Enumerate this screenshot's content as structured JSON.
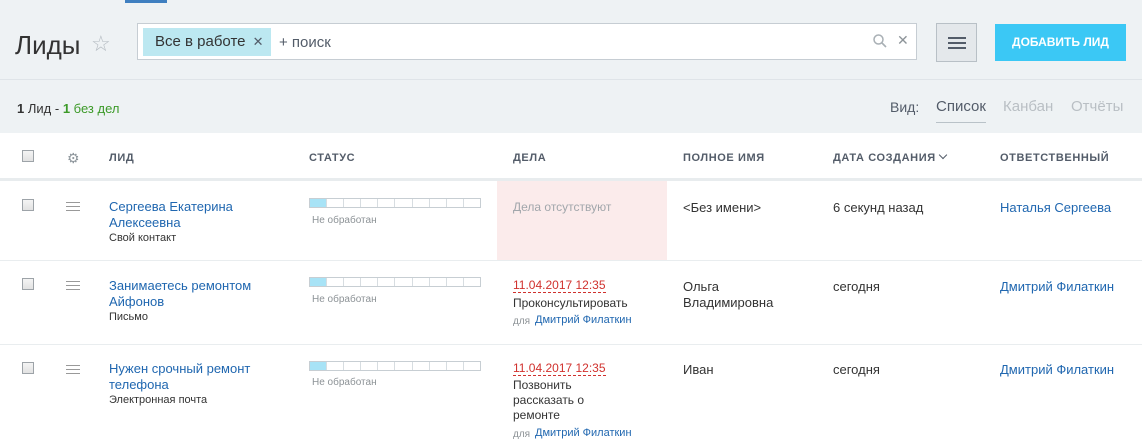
{
  "header": {
    "title": "Лиды",
    "add_button": "ДОБАВИТЬ ЛИД"
  },
  "search": {
    "filter_tag": "Все в работе",
    "placeholder": "+ поиск"
  },
  "summary": {
    "count": "1",
    "count_label": "Лид -",
    "no_deals_count": "1",
    "no_deals_label": "без дел"
  },
  "view": {
    "label": "Вид:",
    "tabs": [
      "Список",
      "Канбан",
      "Отчёты"
    ],
    "active": "Список"
  },
  "columns": {
    "lead": "ЛИД",
    "status": "СТАТУС",
    "deals": "ДЕЛА",
    "full_name": "ПОЛНОЕ ИМЯ",
    "created": "ДАТА СОЗДАНИЯ",
    "responsible": "ОТВЕТСТВЕННЫЙ"
  },
  "rows": [
    {
      "title_line1": "Сергеева Екатерина",
      "title_line2": "Алексеевна",
      "source": "Свой контакт",
      "status": "Не обработан",
      "deals_empty": "Дела отсутствуют",
      "full_name_line1": "<Без имени>",
      "full_name_line2": "",
      "created": "6 секунд назад",
      "responsible": "Наталья Сергеева"
    },
    {
      "title_line1": "Занимаетесь ремонтом",
      "title_line2": "Айфонов",
      "source": "Письмо",
      "status": "Не обработан",
      "deal_date": "11.04.2017 12:35",
      "deal_title": "Проконсультировать",
      "deal_for": "для",
      "deal_owner": "Дмитрий Филаткин",
      "full_name_line1": "Ольга",
      "full_name_line2": "Владимировна",
      "created": "сегодня",
      "responsible": "Дмитрий Филаткин"
    },
    {
      "title_line1": "Нужен срочный ремонт",
      "title_line2": "телефона",
      "source": "Электронная почта",
      "status": "Не обработан",
      "deal_date": "11.04.2017 12:35",
      "deal_title_line1": "Позвонить",
      "deal_title_line2": "рассказать о",
      "deal_title_line3": "ремонте",
      "deal_for": "для",
      "deal_owner": "Дмитрий Филаткин",
      "full_name_line1": "Иван",
      "full_name_line2": "",
      "created": "сегодня",
      "responsible": "Дмитрий Филаткин"
    }
  ],
  "status_progress": [
    1,
    10
  ],
  "colors": {
    "accent": "#3bc8f5",
    "link": "#2067b0",
    "overdue": "#d0312d",
    "filter_tag_bg": "#bce8f1",
    "no_deals_bg": "#fbebeb"
  }
}
